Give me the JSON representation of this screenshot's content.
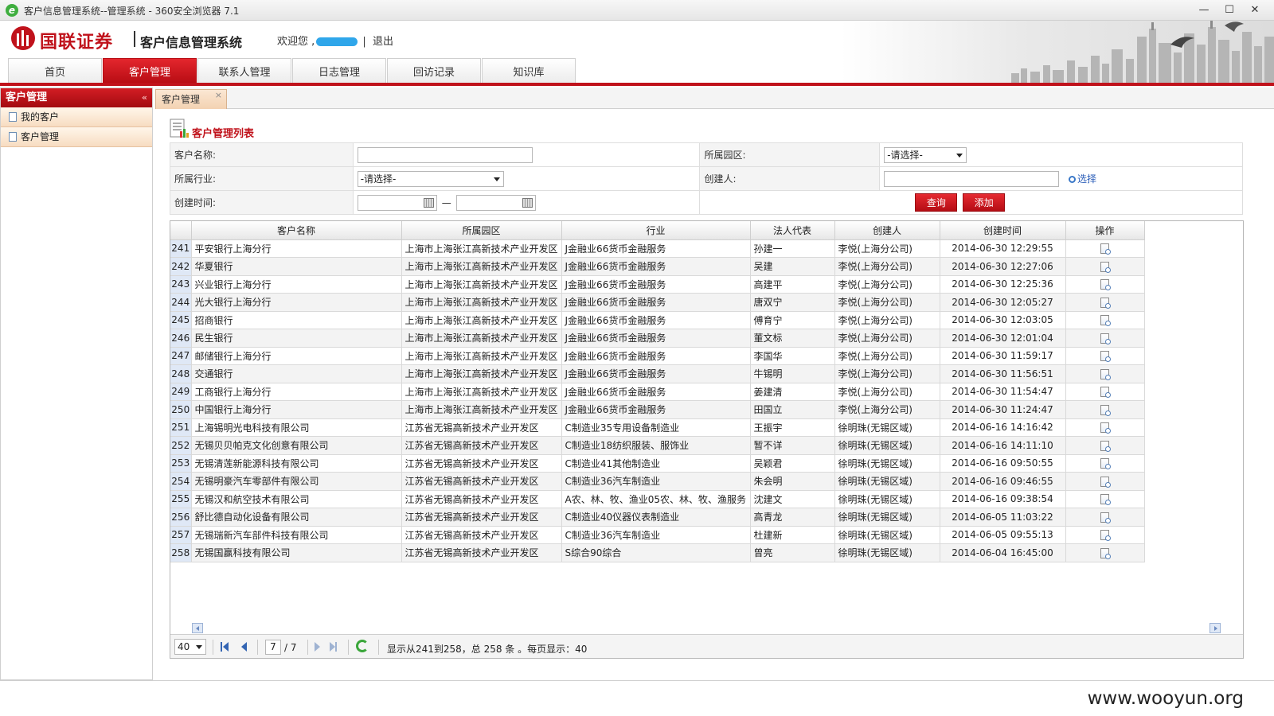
{
  "browser": {
    "title": "客户信息管理系统--管理系统 - 360安全浏览器 7.1",
    "icon": "e",
    "controls": {
      "minimize": "—",
      "maximize": "☐",
      "close": "✕"
    }
  },
  "header": {
    "brand": "国联证券",
    "system_name": "客户信息管理系统",
    "welcome": "欢迎您 ,",
    "logout_sep": "|",
    "logout": "退出"
  },
  "nav": {
    "tabs": [
      {
        "label": "首页",
        "active": false
      },
      {
        "label": "客户管理",
        "active": true
      },
      {
        "label": "联系人管理",
        "active": false
      },
      {
        "label": "日志管理",
        "active": false
      },
      {
        "label": "回访记录",
        "active": false
      },
      {
        "label": "知识库",
        "active": false
      }
    ]
  },
  "sidebar": {
    "title": "客户管理",
    "collapse": "«",
    "items": [
      {
        "label": "我的客户"
      },
      {
        "label": "客户管理"
      }
    ]
  },
  "content_tab": {
    "label": "客户管理",
    "close": "×"
  },
  "panel": {
    "title": "客户管理列表"
  },
  "search": {
    "customer_name_label": "客户名称:",
    "customer_name_value": "",
    "park_label": "所属园区:",
    "park_value": "-请选择-",
    "industry_label": "所属行业:",
    "industry_value": "-请选择-",
    "creator_label": "创建人:",
    "creator_value": "",
    "pick_label": "选择",
    "created_time_label": "创建时间:",
    "date_sep": "—",
    "query_button": "查询",
    "add_button": "添加"
  },
  "grid": {
    "columns": [
      "客户名称",
      "所属园区",
      "行业",
      "法人代表",
      "创建人",
      "创建时间",
      "操作"
    ],
    "rows": [
      {
        "num": "241",
        "name": "平安银行上海分行",
        "park": "上海市上海张江高新技术产业开发区",
        "industry": "J金融业66货币金融服务",
        "legal": "孙建一",
        "creator": "李悦(上海分公司)",
        "time": "2014-06-30 12:29:55"
      },
      {
        "num": "242",
        "name": "华夏银行",
        "park": "上海市上海张江高新技术产业开发区",
        "industry": "J金融业66货币金融服务",
        "legal": "吴建",
        "creator": "李悦(上海分公司)",
        "time": "2014-06-30 12:27:06"
      },
      {
        "num": "243",
        "name": "兴业银行上海分行",
        "park": "上海市上海张江高新技术产业开发区",
        "industry": "J金融业66货币金融服务",
        "legal": "高建平",
        "creator": "李悦(上海分公司)",
        "time": "2014-06-30 12:25:36"
      },
      {
        "num": "244",
        "name": "光大银行上海分行",
        "park": "上海市上海张江高新技术产业开发区",
        "industry": "J金融业66货币金融服务",
        "legal": "唐双宁",
        "creator": "李悦(上海分公司)",
        "time": "2014-06-30 12:05:27"
      },
      {
        "num": "245",
        "name": "招商银行",
        "park": "上海市上海张江高新技术产业开发区",
        "industry": "J金融业66货币金融服务",
        "legal": "傅育宁",
        "creator": "李悦(上海分公司)",
        "time": "2014-06-30 12:03:05"
      },
      {
        "num": "246",
        "name": "民生银行",
        "park": "上海市上海张江高新技术产业开发区",
        "industry": "J金融业66货币金融服务",
        "legal": "董文标",
        "creator": "李悦(上海分公司)",
        "time": "2014-06-30 12:01:04"
      },
      {
        "num": "247",
        "name": "邮储银行上海分行",
        "park": "上海市上海张江高新技术产业开发区",
        "industry": "J金融业66货币金融服务",
        "legal": "李国华",
        "creator": "李悦(上海分公司)",
        "time": "2014-06-30 11:59:17"
      },
      {
        "num": "248",
        "name": "交通银行",
        "park": "上海市上海张江高新技术产业开发区",
        "industry": "J金融业66货币金融服务",
        "legal": "牛锡明",
        "creator": "李悦(上海分公司)",
        "time": "2014-06-30 11:56:51"
      },
      {
        "num": "249",
        "name": "工商银行上海分行",
        "park": "上海市上海张江高新技术产业开发区",
        "industry": "J金融业66货币金融服务",
        "legal": "姜建清",
        "creator": "李悦(上海分公司)",
        "time": "2014-06-30 11:54:47"
      },
      {
        "num": "250",
        "name": "中国银行上海分行",
        "park": "上海市上海张江高新技术产业开发区",
        "industry": "J金融业66货币金融服务",
        "legal": "田国立",
        "creator": "李悦(上海分公司)",
        "time": "2014-06-30 11:24:47"
      },
      {
        "num": "251",
        "name": "上海锡明光电科技有限公司",
        "park": "江苏省无锡高新技术产业开发区",
        "industry": "C制造业35专用设备制造业",
        "legal": "王振宇",
        "creator": "徐明珠(无锡区域)",
        "time": "2014-06-16 14:16:42"
      },
      {
        "num": "252",
        "name": "无锡贝贝帕克文化创意有限公司",
        "park": "江苏省无锡高新技术产业开发区",
        "industry": "C制造业18纺织服装、服饰业",
        "legal": "暂不详",
        "creator": "徐明珠(无锡区域)",
        "time": "2014-06-16 14:11:10"
      },
      {
        "num": "253",
        "name": "无锡清莲新能源科技有限公司",
        "park": "江苏省无锡高新技术产业开发区",
        "industry": "C制造业41其他制造业",
        "legal": "吴颖君",
        "creator": "徐明珠(无锡区域)",
        "time": "2014-06-16 09:50:55"
      },
      {
        "num": "254",
        "name": "无锡明豪汽车零部件有限公司",
        "park": "江苏省无锡高新技术产业开发区",
        "industry": "C制造业36汽车制造业",
        "legal": "朱会明",
        "creator": "徐明珠(无锡区域)",
        "time": "2014-06-16 09:46:55"
      },
      {
        "num": "255",
        "name": "无锡汉和航空技术有限公司",
        "park": "江苏省无锡高新技术产业开发区",
        "industry": "A农、林、牧、渔业05农、林、牧、渔服务",
        "legal": "沈建文",
        "creator": "徐明珠(无锡区域)",
        "time": "2014-06-16 09:38:54"
      },
      {
        "num": "256",
        "name": "舒比德自动化设备有限公司",
        "park": "江苏省无锡高新技术产业开发区",
        "industry": "C制造业40仪器仪表制造业",
        "legal": "高青龙",
        "creator": "徐明珠(无锡区域)",
        "time": "2014-06-05 11:03:22"
      },
      {
        "num": "257",
        "name": "无锡瑞新汽车部件科技有限公司",
        "park": "江苏省无锡高新技术产业开发区",
        "industry": "C制造业36汽车制造业",
        "legal": "杜建新",
        "creator": "徐明珠(无锡区域)",
        "time": "2014-06-05 09:55:13"
      },
      {
        "num": "258",
        "name": "无锡国赢科技有限公司",
        "park": "江苏省无锡高新技术产业开发区",
        "industry": "S综合90综合",
        "legal": "曾亮",
        "creator": "徐明珠(无锡区域)",
        "time": "2014-06-04 16:45:00"
      }
    ]
  },
  "pager": {
    "page_size": "40",
    "current_page": "7",
    "total_pages": "/ 7",
    "info": "显示从241到258，总 258 条 。每页显示：40"
  },
  "footer": {
    "watermark": "www.wooyun.org"
  }
}
